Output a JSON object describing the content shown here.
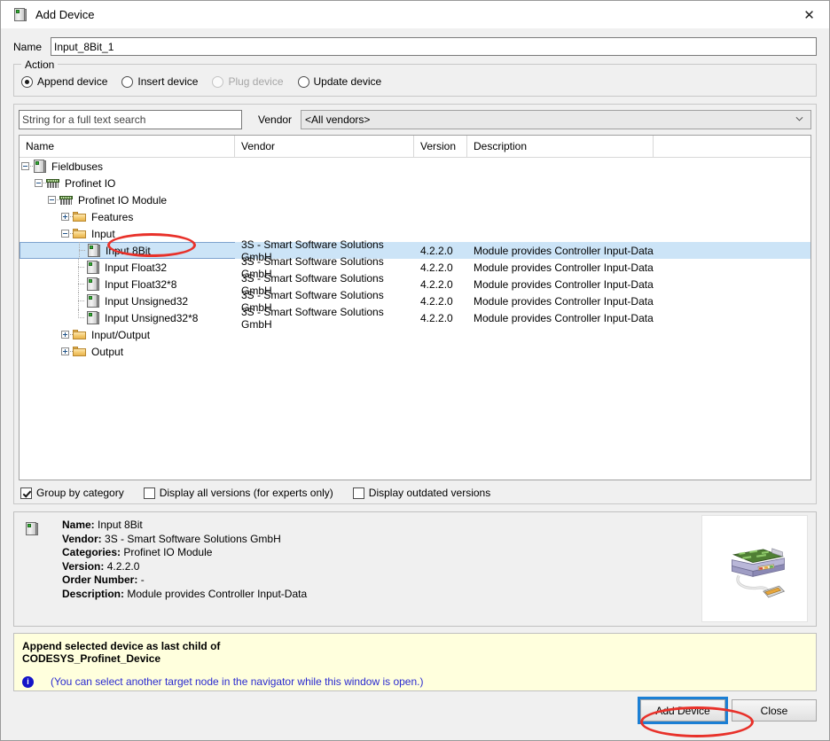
{
  "window": {
    "title": "Add Device",
    "icon": "device-icon",
    "close_icon": "close-icon"
  },
  "name_field": {
    "label": "Name",
    "value": "Input_8Bit_1",
    "placeholder": ""
  },
  "action_group": {
    "title": "Action",
    "options": [
      {
        "label": "Append device",
        "checked": true,
        "disabled": false
      },
      {
        "label": "Insert device",
        "checked": false,
        "disabled": false
      },
      {
        "label": "Plug device",
        "checked": false,
        "disabled": true
      },
      {
        "label": "Update device",
        "checked": false,
        "disabled": false
      }
    ]
  },
  "search": {
    "placeholder": "String for a full text search",
    "value": ""
  },
  "vendor": {
    "label": "Vendor",
    "selected": "<All vendors>"
  },
  "tree": {
    "columns": [
      "Name",
      "Vendor",
      "Version",
      "Description"
    ],
    "rows": [
      {
        "name": "Fieldbuses",
        "depth": 0,
        "expander": "minus",
        "icon": "device-icon",
        "vendor": "",
        "version": "",
        "description": "",
        "selected": false,
        "guide": "none"
      },
      {
        "name": "Profinet IO",
        "depth": 1,
        "expander": "minus",
        "icon": "comb-icon",
        "vendor": "",
        "version": "",
        "description": "",
        "selected": false,
        "guide": "none"
      },
      {
        "name": "Profinet IO Module",
        "depth": 2,
        "expander": "minus",
        "icon": "comb-icon",
        "vendor": "",
        "version": "",
        "description": "",
        "selected": false,
        "guide": "none"
      },
      {
        "name": "Features",
        "depth": 3,
        "expander": "plus",
        "icon": "folder-icon",
        "vendor": "",
        "version": "",
        "description": "",
        "selected": false,
        "guide": "none"
      },
      {
        "name": "Input",
        "depth": 3,
        "expander": "minus",
        "icon": "folder-icon",
        "vendor": "",
        "version": "",
        "description": "",
        "selected": false,
        "guide": "none"
      },
      {
        "name": "Input 8Bit",
        "depth": 4,
        "expander": "none",
        "icon": "device-icon",
        "vendor": "3S - Smart Software Solutions GmbH",
        "version": "4.2.2.0",
        "description": "Module provides Controller Input-Data",
        "selected": true,
        "guide": "tee"
      },
      {
        "name": "Input Float32",
        "depth": 4,
        "expander": "none",
        "icon": "device-icon",
        "vendor": "3S - Smart Software Solutions GmbH",
        "version": "4.2.2.0",
        "description": "Module provides Controller Input-Data",
        "selected": false,
        "guide": "tee"
      },
      {
        "name": "Input Float32*8",
        "depth": 4,
        "expander": "none",
        "icon": "device-icon",
        "vendor": "3S - Smart Software Solutions GmbH",
        "version": "4.2.2.0",
        "description": "Module provides Controller Input-Data",
        "selected": false,
        "guide": "tee"
      },
      {
        "name": "Input Unsigned32",
        "depth": 4,
        "expander": "none",
        "icon": "device-icon",
        "vendor": "3S - Smart Software Solutions GmbH",
        "version": "4.2.2.0",
        "description": "Module provides Controller Input-Data",
        "selected": false,
        "guide": "tee"
      },
      {
        "name": "Input Unsigned32*8",
        "depth": 4,
        "expander": "none",
        "icon": "device-icon",
        "vendor": "3S - Smart Software Solutions GmbH",
        "version": "4.2.2.0",
        "description": "Module provides Controller Input-Data",
        "selected": false,
        "guide": "ell"
      },
      {
        "name": "Input/Output",
        "depth": 3,
        "expander": "plus",
        "icon": "folder-icon",
        "vendor": "",
        "version": "",
        "description": "",
        "selected": false,
        "guide": "none"
      },
      {
        "name": "Output",
        "depth": 3,
        "expander": "plus",
        "icon": "folder-icon",
        "vendor": "",
        "version": "",
        "description": "",
        "selected": false,
        "guide": "none"
      }
    ]
  },
  "options_row": [
    {
      "label": "Group by category",
      "checked": true
    },
    {
      "label": "Display all versions (for experts only)",
      "checked": false
    },
    {
      "label": "Display outdated versions",
      "checked": false
    }
  ],
  "details": {
    "icon": "device-icon",
    "fields": [
      {
        "key": "Name:",
        "value": "Input 8Bit"
      },
      {
        "key": "Vendor:",
        "value": "3S - Smart Software Solutions GmbH"
      },
      {
        "key": "Categories:",
        "value": "Profinet IO Module"
      },
      {
        "key": "Version:",
        "value": "4.2.2.0"
      },
      {
        "key": "Order Number:",
        "value": "-"
      },
      {
        "key": "Description:",
        "value": "Module provides Controller Input-Data"
      }
    ],
    "thumbnail": "device-photo"
  },
  "infobar": {
    "line1": "Append selected device as last child of",
    "line2": "CODESYS_Profinet_Device",
    "note_icon": "info-icon",
    "note": "(You can select another target node in the navigator while this window is open.)"
  },
  "buttons": {
    "add_device": "Add Device",
    "close": "Close"
  },
  "colors": {
    "selection": "#cce4f7",
    "infobar_bg": "#ffffdd",
    "annotation": "#e8312a",
    "focus": "#1b7fd4",
    "note_text": "#2b2bd0"
  }
}
